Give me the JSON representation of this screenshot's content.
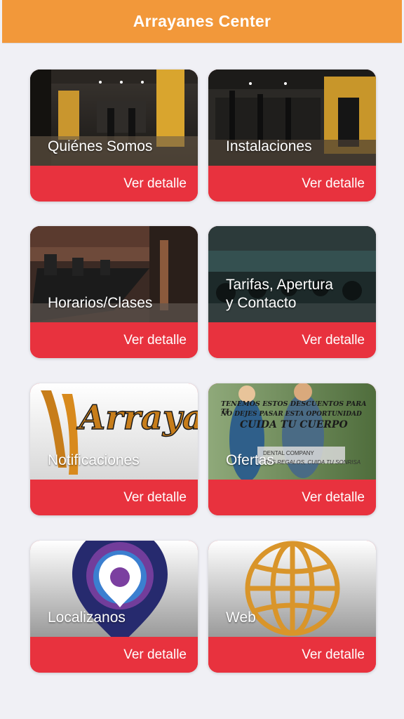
{
  "header": {
    "title": "Arrayanes Center"
  },
  "cards": [
    {
      "title": "Quiénes Somos",
      "button": "Ver detalle",
      "image": "gym-interior-yellow-pillars"
    },
    {
      "title": "Instalaciones",
      "button": "Ver detalle",
      "image": "gym-weight-machines"
    },
    {
      "title": "Horarios/Clases",
      "button": "Ver detalle",
      "image": "gym-treadmills"
    },
    {
      "title_lines": [
        "Tarifas, Apertura",
        "y Contacto"
      ],
      "button": "Ver detalle",
      "image": "gym-spinning-bikes"
    },
    {
      "title": "Notificaciones",
      "button": "Ver detalle",
      "image": "arrayanes-logo"
    },
    {
      "title": "Ofertas",
      "button": "Ver detalle",
      "image": "dental-offer-banner",
      "banner": {
        "line1": "TENEMOS ESTOS DESCUENTOS PARA TI",
        "line2": "NO DEJES PASAR ESTA OPORTUNIDAD",
        "line3": "CUIDA TU CUERPO",
        "line4": "DENTAL COMPANY",
        "line5": "TUS REGALOS, CUIDA TU SONRISA"
      }
    },
    {
      "title": "Localizanos",
      "button": "Ver detalle",
      "image": "map-pin-icon"
    },
    {
      "title": "Web",
      "button": "Ver detalle",
      "image": "globe-icon"
    }
  ],
  "colors": {
    "header": "#f2983a",
    "button": "#e8323e",
    "background": "#f0f0f5",
    "globe": "#d9952a",
    "pin_outer": "#262a6e",
    "pin_inner": "#7b3fa0"
  }
}
